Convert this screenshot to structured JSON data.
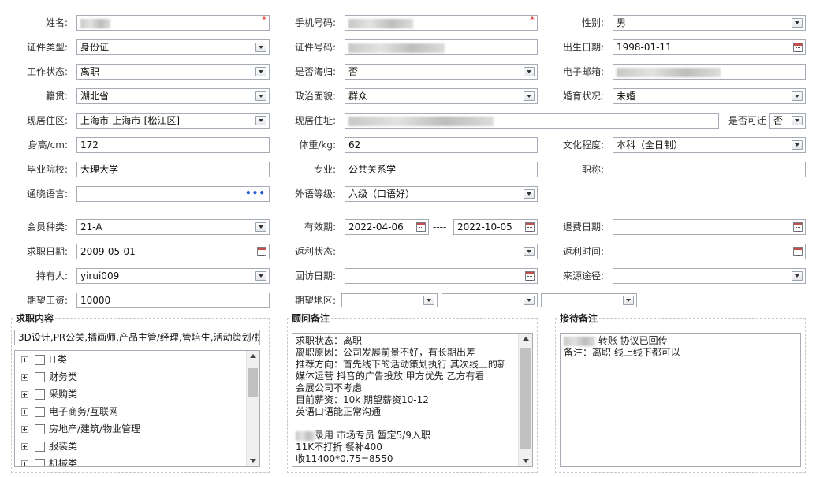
{
  "form": {
    "name_label": "姓名:",
    "phone_label": "手机号码:",
    "gender_label": "性别:",
    "gender_value": "男",
    "id_type_label": "证件类型:",
    "id_type_value": "身份证",
    "id_no_label": "证件号码:",
    "birth_label": "出生日期:",
    "birth_value": "1998-01-11",
    "work_status_label": "工作状态:",
    "work_status_value": "离职",
    "overseas_label": "是否海归:",
    "overseas_value": "否",
    "email_label": "电子邮箱:",
    "native_label": "籍贯:",
    "native_value": "湖北省",
    "political_label": "政治面貌:",
    "political_value": "群众",
    "marital_label": "婚育状况:",
    "marital_value": "未婚",
    "residence_label": "现居住区:",
    "residence_value": "上海市-上海市-[松江区]",
    "address_label": "现居住址:",
    "relocate_label": "是否可迁",
    "relocate_value": "否",
    "height_label": "身高/cm:",
    "height_value": "172",
    "weight_label": "体重/kg:",
    "weight_value": "62",
    "education_label": "文化程度:",
    "education_value": "本科（全日制）",
    "school_label": "毕业院校:",
    "school_value": "大理大学",
    "major_label": "专业:",
    "major_value": "公共关系学",
    "title_label": "职称:",
    "language_label": "通晓语言:",
    "foreign_level_label": "外语等级:",
    "foreign_level_value": "六级（口语好）",
    "required_mark": "*",
    "more_dots": "•••"
  },
  "member": {
    "type_label": "会员种类:",
    "type_value": "21-A",
    "valid_label": "有效期:",
    "valid_from": "2022-04-06",
    "valid_sep": "----",
    "valid_to": "2022-10-05",
    "refund_date_label": "退费日期:",
    "job_date_label": "求职日期:",
    "job_date_value": "2009-05-01",
    "rebate_status_label": "返利状态:",
    "rebate_time_label": "返利时间:",
    "holder_label": "持有人:",
    "holder_value": "yirui009",
    "visit_date_label": "回访日期:",
    "source_label": "来源途径:",
    "salary_label": "期望工资:",
    "salary_value": "10000",
    "area_label": "期望地区:"
  },
  "job_panel": {
    "title": "求职内容",
    "summary": "3D设计,PR公关,插画师,产品主管/经理,管培生,活动策划/执",
    "tree": [
      "IT类",
      "财务类",
      "采购类",
      "电子商务/互联网",
      "房地产/建筑/物业管理",
      "服装类",
      "机械类"
    ]
  },
  "advisor_panel": {
    "title": "顾问备注",
    "lines": [
      "求职状态：离职",
      "离职原因：公司发展前景不好，有长期出差",
      "推荐方向：首先线下的活动策划执行 其次线上的新",
      "媒体运营  抖音的广告投放 甲方优先  乙方有看",
      "会展公司不考虑",
      "目前薪资：10k  期望薪资10-12",
      "英语口语能正常沟通",
      "",
      "录用 市场专员 暂定5/9入职",
      "11K不打折  餐补400",
      "收11400*0.75=8550"
    ]
  },
  "reception_panel": {
    "title": "接待备注",
    "line1": " 转账 协议已回传",
    "line2": "备注：离职 线上线下都可以"
  },
  "colors": {
    "border": "#a5acb5",
    "required": "#e02020",
    "link_dots": "#2d5bd1"
  },
  "icons": [
    "dropdown-arrow-icon",
    "calendar-icon",
    "expand-plus-icon",
    "ellipsis-icon"
  ]
}
